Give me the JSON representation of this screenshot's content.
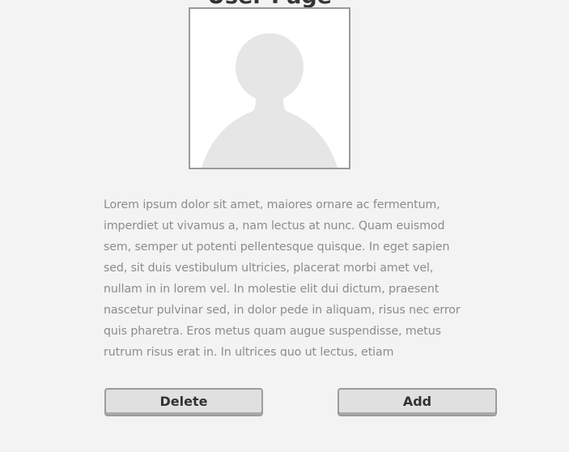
{
  "page": {
    "title": "User Page"
  },
  "avatar": {
    "icon": "person-silhouette-icon",
    "placeholder_color": "#e6e6e6"
  },
  "description": {
    "text": "Lorem ipsum dolor sit amet, maiores ornare ac fermentum, imperdiet ut vivamus a, nam lectus at nunc. Quam euismod sem, semper ut potenti pellentesque quisque. In eget sapien sed, sit duis vestibulum ultricies, placerat morbi amet vel, nullam in in lorem vel. In molestie elit dui dictum, praesent nascetur pulvinar sed, in dolor pede in aliquam, risus nec error quis pharetra. Eros metus quam augue suspendisse, metus rutrum risus erat in. In ultrices quo ut lectus, etiam"
  },
  "actions": {
    "delete_label": "Delete",
    "add_label": "Add"
  },
  "colors": {
    "background": "#f3f3f3",
    "button_fill": "#e0e0e0",
    "button_border": "#9c9c9c",
    "text_muted": "#8c8c8c",
    "text_dark": "#333333"
  }
}
